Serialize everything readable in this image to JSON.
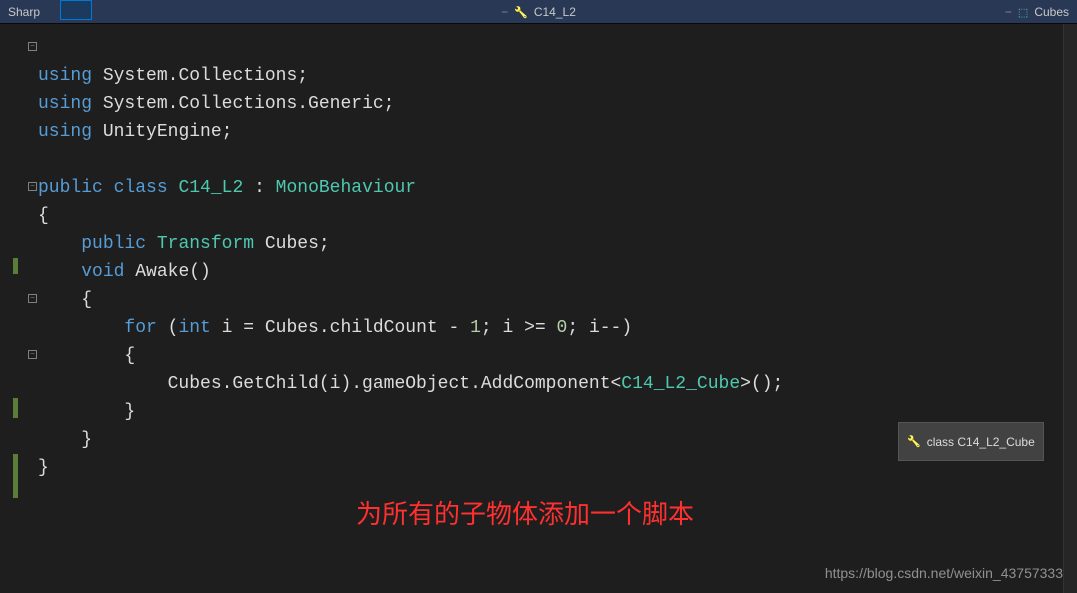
{
  "tabBar": {
    "leftLabel": "Sharp",
    "centerLabel": "C14_L2",
    "rightLabel": "Cubes"
  },
  "code": {
    "line1_kw": "using",
    "line1_ns": "System.Collections;",
    "line2_kw": "using",
    "line2_ns": "System.Collections.Generic;",
    "line3_kw": "using",
    "line3_ns": "UnityEngine;",
    "line5_kw1": "public",
    "line5_kw2": "class",
    "line5_cls": "C14_L2",
    "line5_colon": " : ",
    "line5_base": "MonoBehaviour",
    "line6_brace": "{",
    "line7_kw": "public",
    "line7_type": "Transform",
    "line7_name": " Cubes;",
    "line8_kw": "void",
    "line8_name": " Awake()",
    "line9_brace": "    {",
    "line10_kw": "for",
    "line10_open": " (",
    "line10_int": "int",
    "line10_expr1": " i = Cubes.childCount - ",
    "line10_num1": "1",
    "line10_expr2": "; i >= ",
    "line10_num0": "0",
    "line10_expr3": "; i--)",
    "line11_brace": "        {",
    "line12_body": "            Cubes.GetChild(i).gameObject.AddComponent<",
    "line12_type": "C14_L2_Cube",
    "line12_end": ">();",
    "line13_brace": "        }",
    "line14_brace": "    }",
    "line15_brace": "}"
  },
  "tooltip": "class C14_L2_Cube",
  "annotation": "为所有的子物体添加一个脚本",
  "watermark": "https://blog.csdn.net/weixin_43757333"
}
